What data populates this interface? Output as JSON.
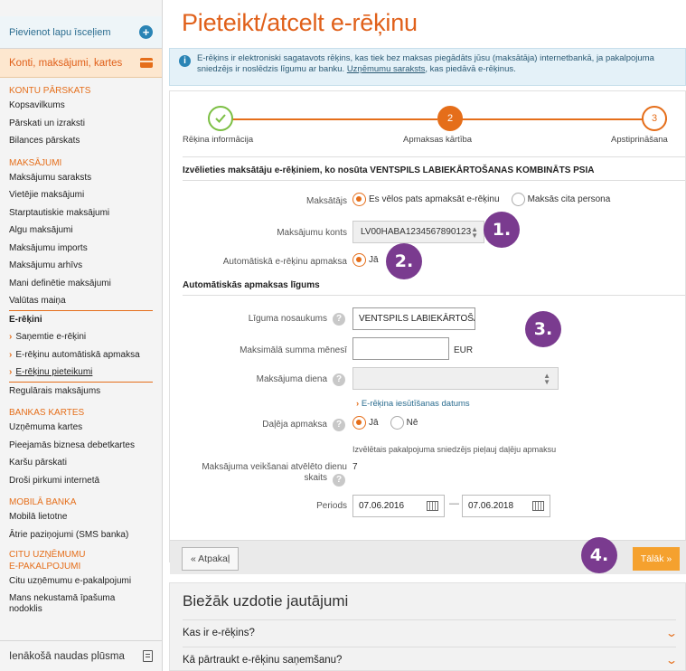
{
  "sidebar": {
    "add_home": "Pievienot lapu īsceļiem",
    "accounts": "Konti, maksājumi, kartes",
    "groups": [
      {
        "title": "KONTU PĀRSKATS",
        "items": [
          "Kopsavilkums",
          "Pārskati un izraksti",
          "Bilances pārskats"
        ]
      },
      {
        "title": "MAKSĀJUMI",
        "items": [
          "Maksājumu saraksts",
          "Vietējie maksājumi",
          "Starptautiskie maksājumi",
          "Algu maksājumi",
          "Maksājumu imports",
          "Maksājumu arhīvs",
          "Mani definētie maksājumi",
          "Valūtas maiņa"
        ]
      }
    ],
    "erekini": "E-rēķini",
    "erekini_sub": [
      "Saņemtie e-rēķini",
      "E-rēķinu automātiskā apmaksa",
      "E-rēķinu pieteikumi"
    ],
    "regular": "Regulārais maksājums",
    "groups2": [
      {
        "title": "BANKAS KARTES",
        "items": [
          "Uzņēmuma kartes",
          "Pieejamās biznesa debetkartes",
          "Karšu pārskati",
          "Droši pirkumi internetā"
        ]
      },
      {
        "title": "MOBILĀ BANKA",
        "items": [
          "Mobilā lietotne",
          "Ātrie paziņojumi (SMS banka)"
        ]
      }
    ],
    "other_title_1": "CITU UZŅĒMUMU",
    "other_title_2": "E-PAKALPOJUMI",
    "other_items": [
      "Citu uzņēmumu e-pakalpojumi",
      "Mans nekustamā īpašuma nodoklis"
    ],
    "cashflow": "Ienākošā naudas plūsma"
  },
  "main": {
    "title": "Pieteikt/atcelt e-rēķinu",
    "info_text": "E-rēķins ir elektroniski sagatavots rēķins, kas tiek bez maksas piegādāts jūsu (maksātāja) internetbankā, ja pakalpojuma sniedzējs ir noslēdzis līgumu ar banku.",
    "info_link": "Uzņēmumu saraksts",
    "info_tail": ", kas piedāvā e-rēķinus.",
    "steps": [
      {
        "num": "",
        "label": "Rēķina informācija"
      },
      {
        "num": "2",
        "label": "Apmaksas kārtība"
      },
      {
        "num": "3",
        "label": "Apstiprināšana"
      }
    ],
    "payer_heading": "Izvēlieties maksātāju e-rēķiniem, ko nosūta VENTSPILS LABIEKĀRTOŠANAS KOMBINĀTS PSIA",
    "payer_label": "Maksātājs",
    "payer_opt1": "Es vēlos pats apmaksāt e-rēķinu",
    "payer_opt2": "Maksās cita persona",
    "account_label": "Maksājumu konts",
    "account_value": "LV00HABA1234567890123",
    "auto_label": "Automātiskā e-rēķinu apmaksa",
    "auto_yes": "Jā",
    "contract_heading": "Automātiskās apmaksas līgums",
    "contract_name_label": "Līguma nosaukums",
    "contract_name_value": "VENTSPILS LABIEKĀRTOŠAN",
    "max_label": "Maksimālā summa mēnesī",
    "max_value": "",
    "currency": "EUR",
    "day_label": "Maksājuma diena",
    "issue_date_link": "E-rēķina iesūtīšanas datums",
    "partial_label": "Daļēja apmaksa",
    "partial_yes": "Jā",
    "partial_no": "Nē",
    "partial_note": "Izvēlētais pakalpojuma sniedzējs pieļauj daļēju apmaksu",
    "days_label_1": "Maksājuma veikšanai atvēlēto dienu",
    "days_label_2": "skaits",
    "days_value": "7",
    "period_label": "Periods",
    "period_from": "07.06.2016",
    "period_to": "07.06.2018",
    "period_dash": "—",
    "back_button": "« Atpakaļ",
    "next_button": "Tālāk »",
    "badges": [
      "1.",
      "2.",
      "3.",
      "4."
    ],
    "faq_title": "Biežāk uzdotie jautājumi",
    "faq_items": [
      "Kas ir e-rēķins?",
      "Kā pārtraukt e-rēķinu saņemšanu?"
    ]
  },
  "colors": {
    "accent": "#e56e1a",
    "badge": "#7a3b8f",
    "next": "#f5a12e",
    "done": "#7cbf44"
  }
}
